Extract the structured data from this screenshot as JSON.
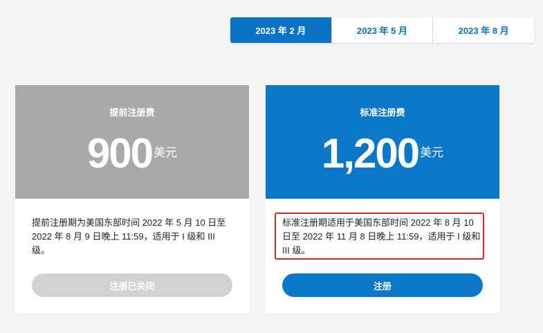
{
  "tabs": [
    {
      "label": "2023 年 2 月",
      "active": true
    },
    {
      "label": "2023 年 5 月",
      "active": false
    },
    {
      "label": "2023 年 8 月",
      "active": false
    }
  ],
  "cards": {
    "early": {
      "title": "提前注册费",
      "price": "900",
      "currency": "美元",
      "description": "提前注册期为美国东部时间 2022 年 5 月 10 日至 2022 年 8 月 9 日晚上 11:59，适用于 I 级和 III 级。",
      "button_label": "注册已关闭",
      "color": "#a9a9aa"
    },
    "standard": {
      "title": "标准注册费",
      "price": "1,200",
      "currency": "美元",
      "description": "标准注册期适用于美国东部时间 2022 年 8 月 10 日至 2022 年 11 月 8 日晚上 11:59，适用于 I 级和 III 级。",
      "button_label": "注册",
      "color": "#0a77c9"
    }
  }
}
